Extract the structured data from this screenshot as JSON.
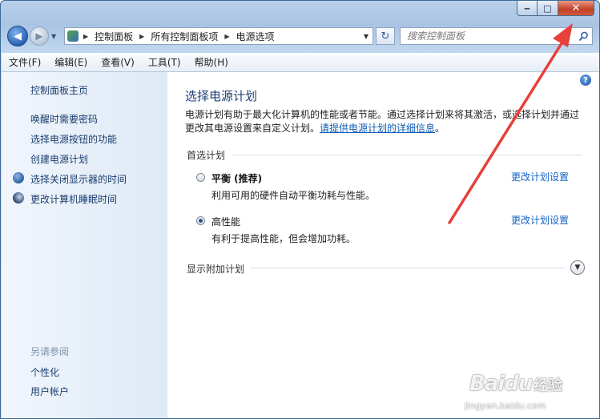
{
  "window": {
    "caption": {
      "minimize": "‒",
      "maximize": "□",
      "close": "✕"
    }
  },
  "address": {
    "crumbs": [
      "控制面板",
      "所有控制面板项",
      "电源选项"
    ]
  },
  "search": {
    "placeholder": "搜索控制面板"
  },
  "menu": [
    "文件(F)",
    "编辑(E)",
    "查看(V)",
    "工具(T)",
    "帮助(H)"
  ],
  "sidebar": {
    "home": "控制面板主页",
    "links": [
      "唤醒时需要密码",
      "选择电源按钮的功能",
      "创建电源计划",
      "选择关闭显示器的时间",
      "更改计算机睡眠时间"
    ],
    "see_also_title": "另请参阅",
    "see_also": [
      "个性化",
      "用户帐户"
    ]
  },
  "main": {
    "help": "?",
    "title": "选择电源计划",
    "desc_text": "电源计划有助于最大化计算机的性能或者节能。通过选择计划来将其激活，或选择计划并通过更改其电源设置来自定义计划。",
    "desc_link": "请提供电源计划的详细信息",
    "desc_end": "。",
    "preferred_label": "首选计划",
    "plans": [
      {
        "name": "平衡 (推荐)",
        "desc": "利用可用的硬件自动平衡功耗与性能。",
        "selected": false,
        "link": "更改计划设置"
      },
      {
        "name": "高性能",
        "desc": "有利于提高性能，但会增加功耗。",
        "selected": true,
        "link": "更改计划设置"
      }
    ],
    "additional_label": "显示附加计划"
  },
  "annotation": {
    "arrow_color": "#e8403a"
  },
  "watermark": {
    "logo": "Baidu",
    "cn": "经验",
    "url": "jingyan.baidu.com"
  }
}
